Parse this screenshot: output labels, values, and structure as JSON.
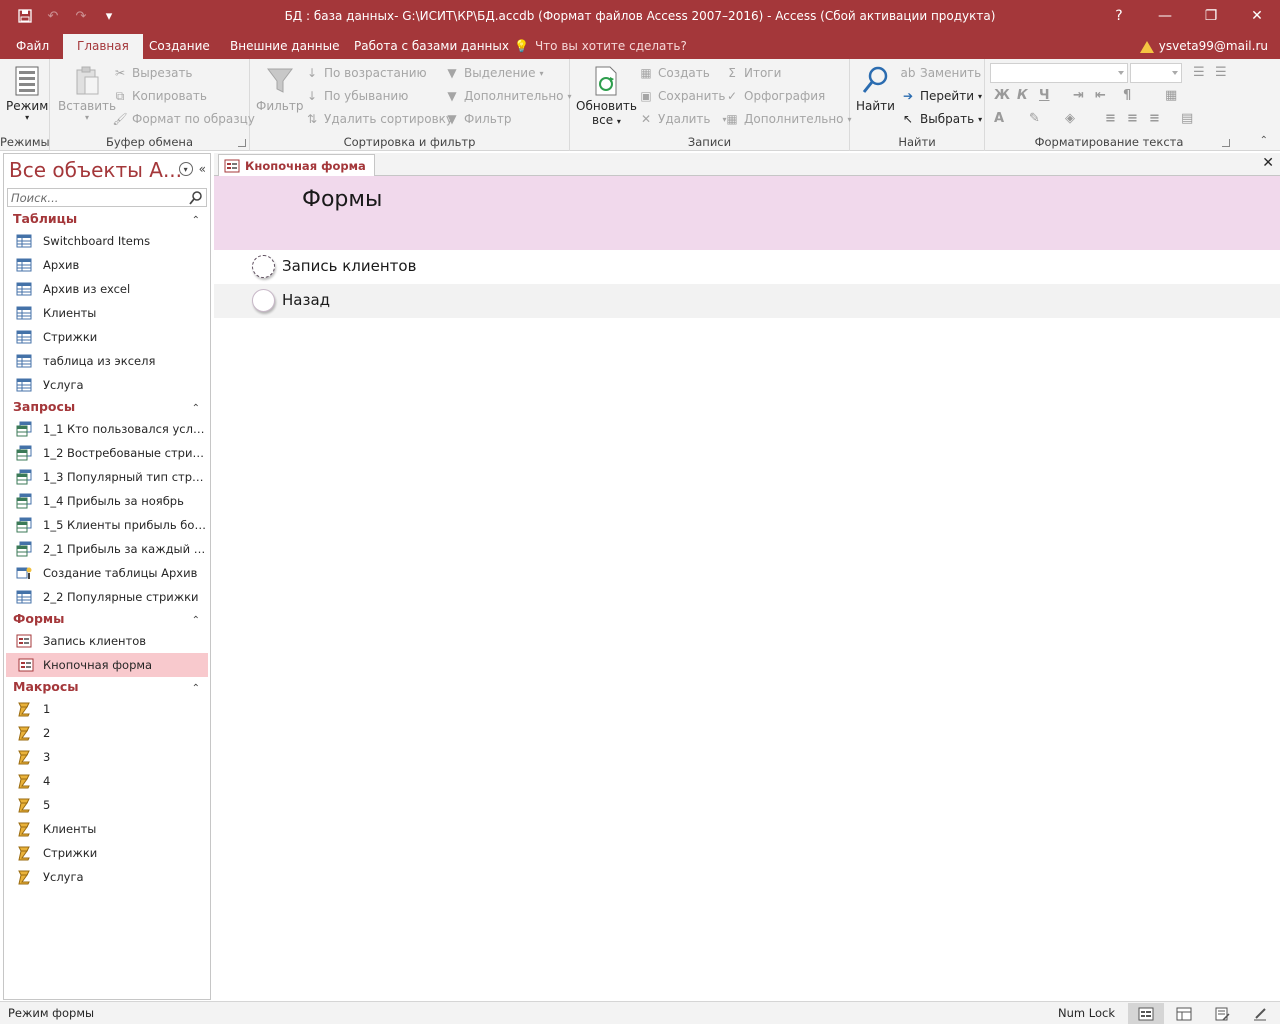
{
  "titlebar": {
    "title": "БД : база данных- G:\\ИСИТ\\КР\\БД.accdb (Формат файлов Access 2007–2016) - Access (Сбой активации продукта)",
    "help": "?",
    "minimize": "—",
    "restore": "❐",
    "close": "✕"
  },
  "tabs": {
    "file": "Файл",
    "home": "Главная",
    "create": "Создание",
    "external": "Внешние данные",
    "dbtools": "Работа с базами данных",
    "tellme": "Что вы хотите сделать?",
    "account": "ysveta99@mail.ru"
  },
  "ribbon": {
    "views": {
      "mode": "Режим",
      "label": "Режимы"
    },
    "clipboard": {
      "paste": "Вставить",
      "cut": "Вырезать",
      "copy": "Копировать",
      "painter": "Формат по образцу",
      "label": "Буфер обмена"
    },
    "sort": {
      "filter": "Фильтр",
      "asc": "По возрастанию",
      "desc": "По убыванию",
      "remove": "Удалить сортировку",
      "selection": "Выделение",
      "advanced": "Дополнительно",
      "toggle": "Фильтр",
      "label": "Сортировка и фильтр"
    },
    "records": {
      "refresh": "Обновить",
      "refresh2": "все",
      "new": "Создать",
      "save": "Сохранить",
      "delete": "Удалить",
      "totals": "Итоги",
      "spelling": "Орфография",
      "more": "Дополнительно",
      "label": "Записи"
    },
    "find": {
      "find": "Найти",
      "replace": "Заменить",
      "goto": "Перейти",
      "select": "Выбрать",
      "label": "Найти"
    },
    "text": {
      "bold": "Ж",
      "italic": "К",
      "underline": "Ч",
      "label": "Форматирование текста"
    }
  },
  "nav": {
    "header": "Все объекты А...",
    "search_placeholder": "Поиск...",
    "sections": [
      {
        "title": "Таблицы",
        "items": [
          "Switchboard Items",
          "Архив",
          "Архив из excel",
          "Клиенты",
          "Стрижки",
          "таблица из экселя",
          "Услуга"
        ]
      },
      {
        "title": "Запросы",
        "items": [
          "1_1 Кто пользовался услуга...",
          "1_2 Востребованые стрижк...",
          "1_3 Популярный тип стриж...",
          "1_4 Прибыль за ноябрь",
          "1_5 Клиенты прибыль боль...",
          "2_1 Прибыль за каждый мес...",
          "Создание таблицы Архив",
          "2_2 Популярные стрижки"
        ]
      },
      {
        "title": "Формы",
        "items": [
          "Запись клиентов",
          "Кнопочная форма"
        ]
      },
      {
        "title": "Макросы",
        "items": [
          "1",
          "2",
          "3",
          "4",
          "5",
          "Клиенты",
          "Стрижки",
          "Услуга"
        ]
      }
    ]
  },
  "document": {
    "tab": "Кнопочная форма",
    "close": "✕",
    "form_title": "Формы",
    "options": [
      "Запись клиентов",
      "Назад"
    ]
  },
  "status": {
    "mode": "Режим формы",
    "numlock": "Num Lock"
  },
  "colors": {
    "accent": "#a4373a",
    "form_header": "#f1d9ec",
    "selected_item": "#f8c9cd"
  }
}
